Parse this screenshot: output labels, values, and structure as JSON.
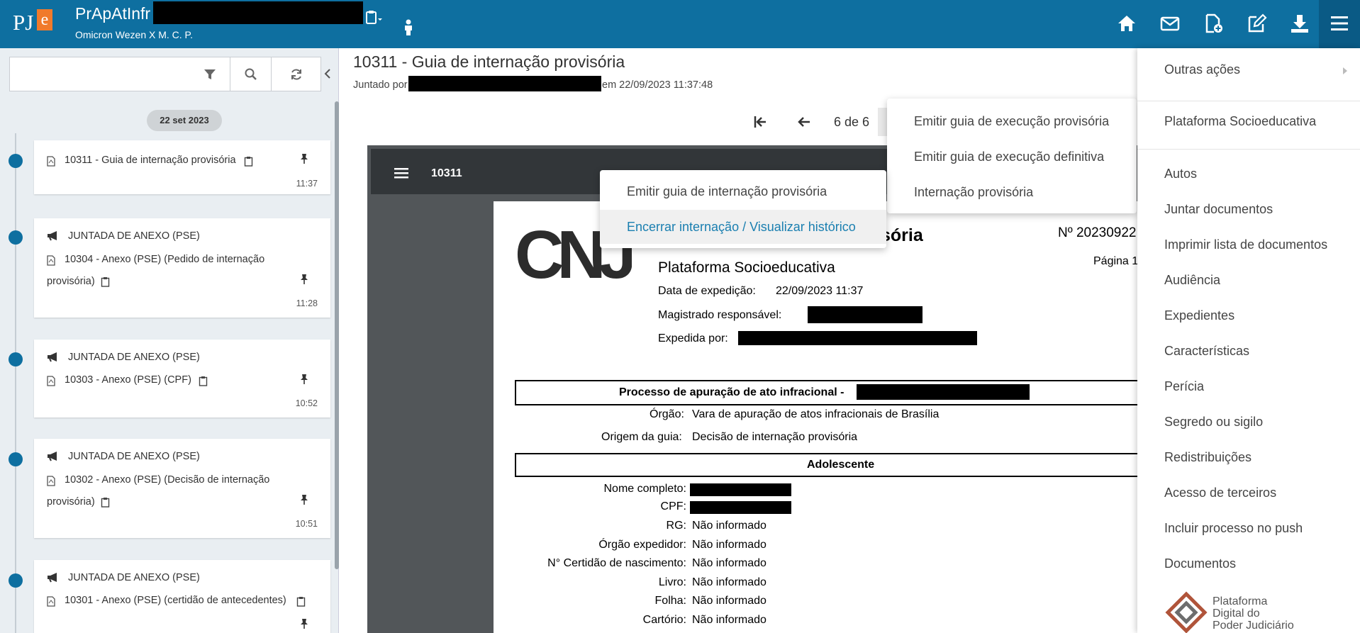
{
  "header": {
    "app_logo": "PJe",
    "process_title": "PrApAtInfr",
    "process_parties": "Omicron Wezen X M. C. P.",
    "icons": [
      "clipboard-icon",
      "person-icon",
      "home-icon",
      "mail-icon",
      "file-add-icon",
      "edit-icon",
      "download-icon",
      "menu-icon"
    ]
  },
  "search": {
    "placeholder": "",
    "value": ""
  },
  "timeline": {
    "date_badge": "22 set 2023",
    "items": [
      {
        "doc": "10311 - Guia de internação provisória",
        "time": "11:37"
      },
      {
        "event": "JUNTADA DE ANEXO (PSE)",
        "doc_line1": "10304 - Anexo (PSE) (Pedido de internação",
        "doc_line2": "provisória)",
        "time": "11:28"
      },
      {
        "event": "JUNTADA DE ANEXO (PSE)",
        "doc": "10303 - Anexo (PSE) (CPF)",
        "time": "10:52"
      },
      {
        "event": "JUNTADA DE ANEXO (PSE)",
        "doc_line1": "10302 - Anexo (PSE) (Decisão de internação",
        "doc_line2": "provisória)",
        "time": "10:51"
      },
      {
        "event": "JUNTADA DE ANEXO (PSE)",
        "doc": "10301 - Anexo (PSE) (certidão de antecedentes)"
      }
    ]
  },
  "document": {
    "title": "10311 - Guia de internação provisória",
    "juntado_prefix": "Juntado por",
    "juntado_suffix": "em 22/09/2023 11:37:48",
    "page_indicator": "6 de 6",
    "pdf_toolbar_name": "10311"
  },
  "pdf": {
    "logo": "CNJ",
    "heading_fragment": "sória",
    "doc_number": "Nº 20230922",
    "page_label": "Página 1",
    "platform": "Plataforma Socioeducativa",
    "expedicao_label": "Data de expedição:",
    "expedicao_value": "22/09/2023 11:37",
    "magistrado_label": "Magistrado responsável:",
    "expedida_label": "Expedida por:",
    "processo_label": "Processo de apuração de ato infracional -",
    "orgao_label": "Órgão:",
    "orgao_value": "Vara de apuração de atos infracionais de Brasília",
    "origem_label": "Origem da guia:",
    "origem_value": "Decisão de internação provisória",
    "adolescente_header": "Adolescente",
    "fields": [
      {
        "label": "Nome completo:",
        "value": ""
      },
      {
        "label": "CPF:",
        "value": ""
      },
      {
        "label": "RG:",
        "value": "Não informado"
      },
      {
        "label": "Órgão expedidor:",
        "value": "Não informado"
      },
      {
        "label": "N° Certidão de nascimento:",
        "value": "Não informado"
      },
      {
        "label": "Livro:",
        "value": "Não informado"
      },
      {
        "label": "Folha:",
        "value": "Não informado"
      },
      {
        "label": "Cartório:",
        "value": "Não informado"
      }
    ]
  },
  "submenu_left": {
    "items": [
      "Emitir guia de internação provisória",
      "Encerrar internação / Visualizar histórico"
    ],
    "highlighted_index": 1
  },
  "submenu_mid": {
    "items": [
      "Emitir guia de execução provisória",
      "Emitir guia de execução definitiva",
      "Internação provisória"
    ]
  },
  "side_menu": {
    "outras_acoes": "Outras ações",
    "plataforma": "Plataforma Socioeducativa",
    "items": [
      "Autos",
      "Juntar documentos",
      "Imprimir lista de documentos",
      "Audiência",
      "Expedientes",
      "Características",
      "Perícia",
      "Segredo ou sigilo",
      "Redistribuições",
      "Acesso de terceiros",
      "Incluir processo no push",
      "Documentos"
    ],
    "footer_logo_text": [
      "Plataforma",
      "Digital do",
      "Poder Judiciário"
    ]
  },
  "colors": {
    "header_bg": "#0e6fa0",
    "accent_link": "#1a7fb0",
    "timeline_dot": "#0e6fa0"
  }
}
